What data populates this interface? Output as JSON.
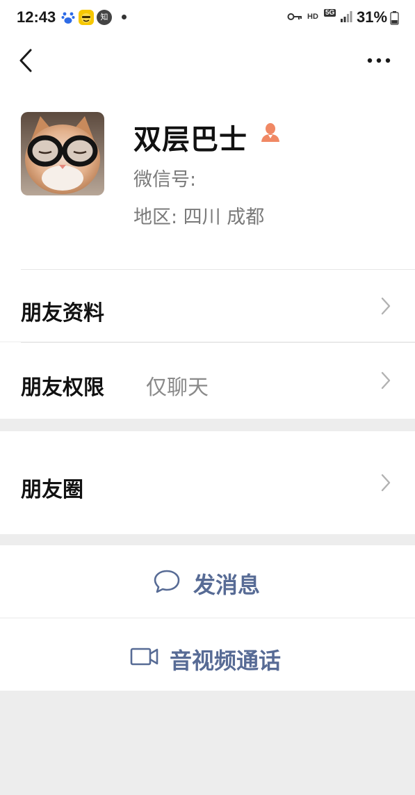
{
  "status_bar": {
    "time": "12:43",
    "app_icons": [
      "baidu-icon",
      "emoji-app-icon",
      "zhihu-icon"
    ],
    "zhihu_glyph": "知",
    "network_hd": "HD",
    "network_type": "5G",
    "battery": "31%"
  },
  "profile": {
    "name": "双层巴士",
    "wechat_id_label": "微信号:",
    "region": "地区:  四川  成都"
  },
  "rows": [
    {
      "title": "朋友资料",
      "value": ""
    },
    {
      "title": "朋友权限",
      "value": "仅聊天"
    },
    {
      "title": "朋友圈",
      "value": ""
    }
  ],
  "actions": {
    "message": "发消息",
    "call": "音视频通话"
  },
  "colors": {
    "accent": "#576b95",
    "badge": "#f08864",
    "background": "#ededed"
  }
}
